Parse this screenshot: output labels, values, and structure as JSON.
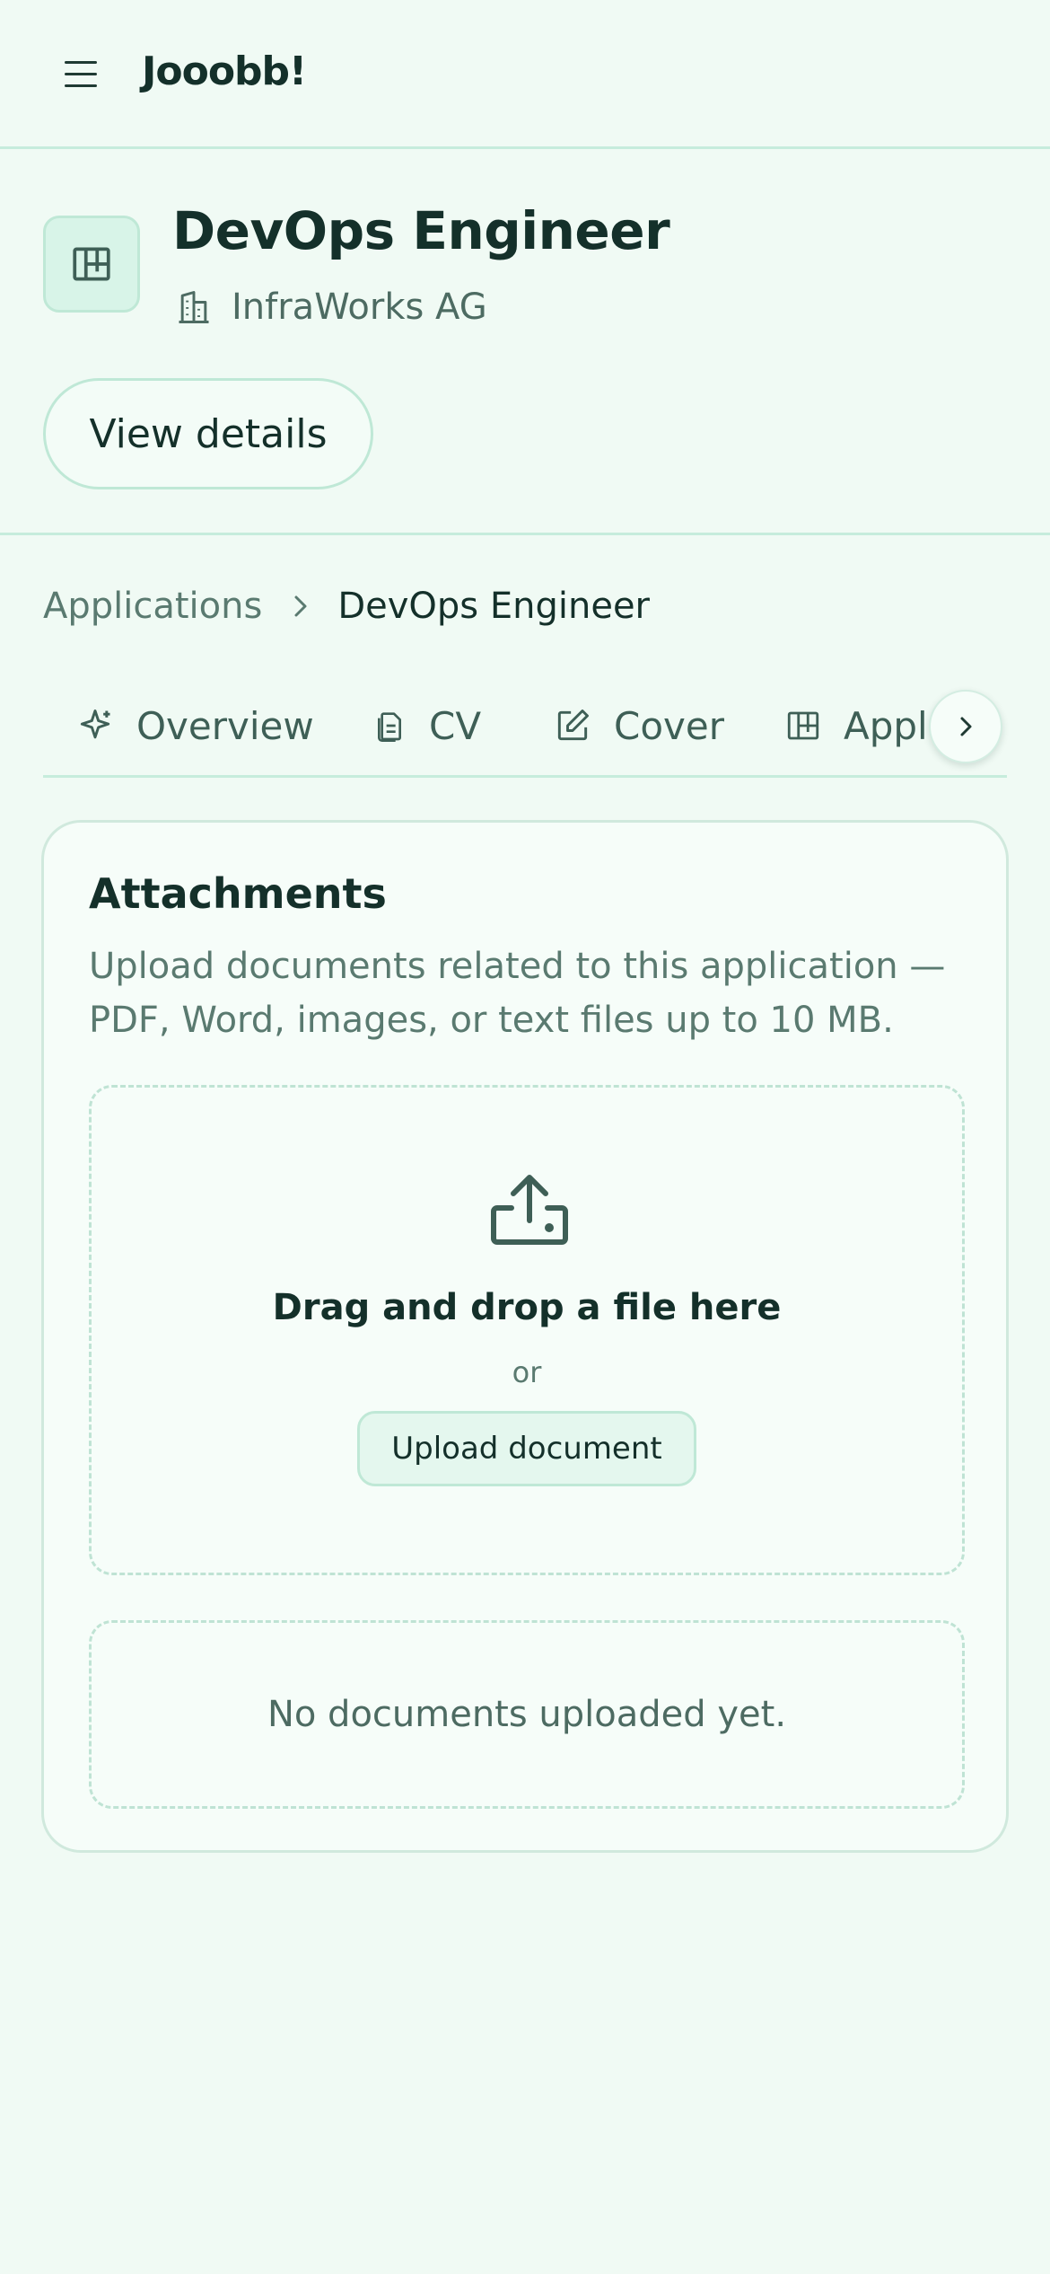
{
  "app": {
    "brand": "Jooobb!"
  },
  "job": {
    "title": "DevOps Engineer",
    "company": "InfraWorks AG",
    "view_details_label": "View details"
  },
  "breadcrumb": {
    "parent": "Applications",
    "current": "DevOps Engineer"
  },
  "tabs": [
    {
      "label": "Overview",
      "icon": "sparkle-icon"
    },
    {
      "label": "CV",
      "icon": "files-icon"
    },
    {
      "label": "Cover",
      "icon": "edit-icon"
    },
    {
      "label": "Appl",
      "icon": "layout-board-icon"
    }
  ],
  "attachments": {
    "title": "Attachments",
    "description": "Upload documents related to this application — PDF, Word, images, or text files up to 10 MB.",
    "dropzone_title": "Drag and drop a file here",
    "dropzone_or": "or",
    "upload_button": "Upload document",
    "empty_message": "No documents uploaded yet."
  },
  "colors": {
    "background": "#f0faf4",
    "card": "#f6fdf9",
    "border": "#c6ecdc",
    "text": "#14302a",
    "muted": "#5a7a70"
  }
}
